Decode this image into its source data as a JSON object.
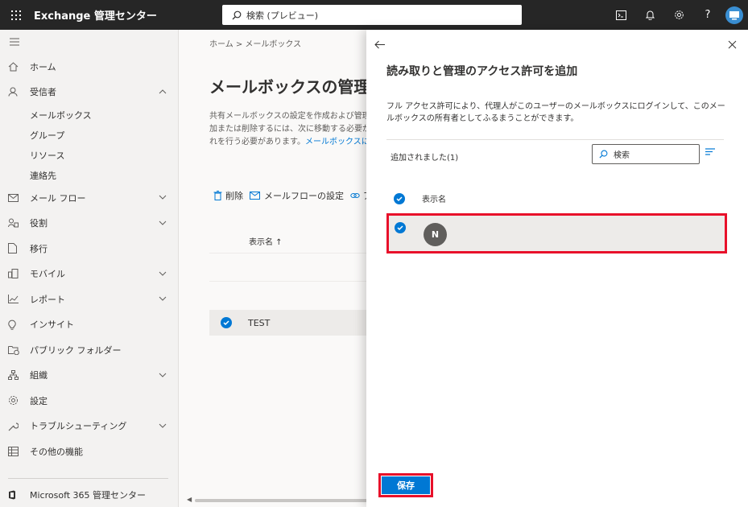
{
  "topbar": {
    "app_title": "Exchange 管理センター",
    "search_placeholder": "検索 (プレビュー)"
  },
  "sidebar": {
    "items": [
      {
        "label": "ホーム"
      },
      {
        "label": "受信者"
      },
      {
        "label": "メール フロー"
      },
      {
        "label": "役割"
      },
      {
        "label": "移行"
      },
      {
        "label": "モバイル"
      },
      {
        "label": "レポート"
      },
      {
        "label": "インサイト"
      },
      {
        "label": "パブリック フォルダー"
      },
      {
        "label": "組織"
      },
      {
        "label": "設定"
      },
      {
        "label": "トラブルシューティング"
      },
      {
        "label": "その他の機能"
      }
    ],
    "recipients_sub": [
      "メールボックス",
      "グループ",
      "リソース",
      "連絡先"
    ],
    "footer": "Microsoft 365 管理センター"
  },
  "main": {
    "breadcrumb": "ホーム > メールボックス",
    "title": "メールボックスの管理",
    "desc_line1": "共有メールボックスの設定を作成および管理",
    "desc_line2": "加または削除するには、次に移動する必要があ",
    "desc_line3": "れを行う必要があります。",
    "desc_link": "メールボックスに関",
    "cmd_delete": "削除",
    "cmd_mailflow": "メールフローの設定",
    "cmd_more": "ア",
    "col_display_name": "表示名 ↑",
    "row_name": "TEST"
  },
  "panel": {
    "title": "読み取りと管理のアクセス許可を追加",
    "desc": "フル アクセス許可により、代理人がこのユーザーのメールボックスにログインして、このメールボックスの所有者としてふるまうことができます。",
    "added_label": "追加されました(1)",
    "search_placeholder": "検索",
    "col_display_name": "表示名",
    "row_initial": "N",
    "save_label": "保存"
  }
}
